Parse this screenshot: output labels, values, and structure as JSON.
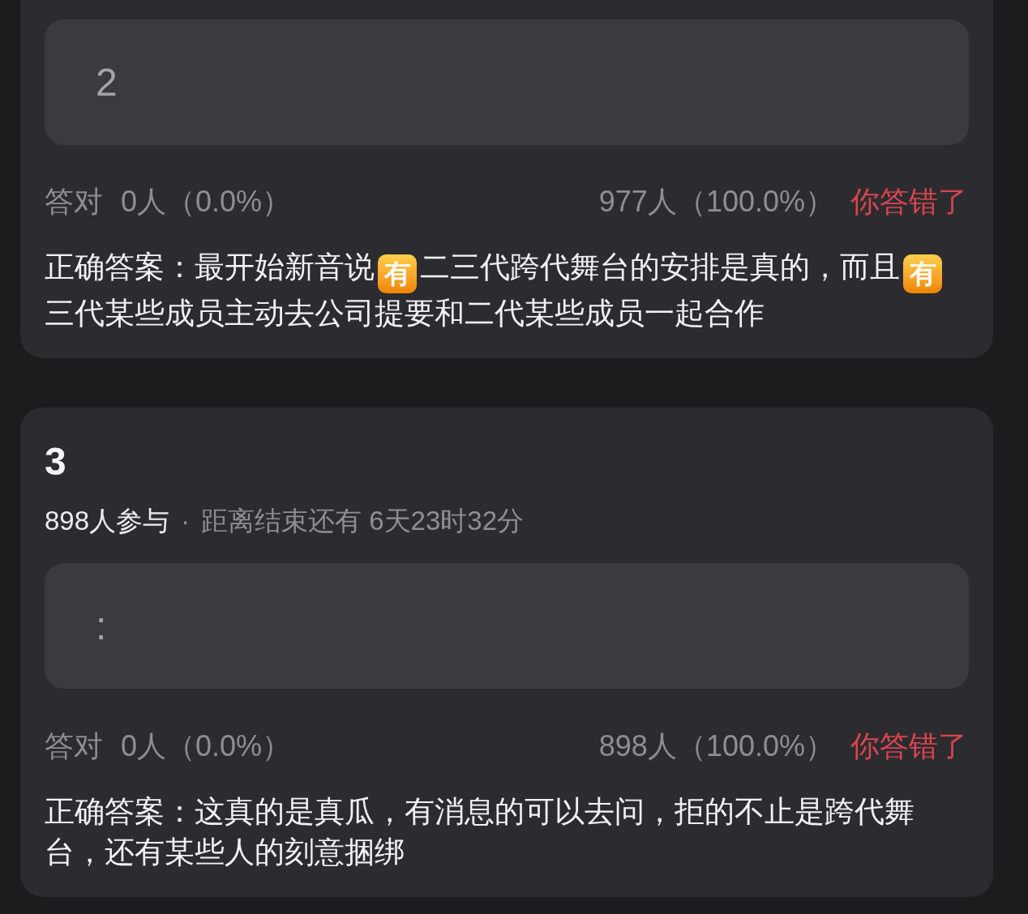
{
  "questions": [
    {
      "user_answer": "2",
      "stats": {
        "correct_label": "答对",
        "correct_count": "0人（0.0%）",
        "wrong_count": "977人（100.0%）",
        "result": "你答错了",
        "answered_correctly": false
      },
      "correct_answer": [
        {
          "kind": "text",
          "text": "正确答案：最开始新音说"
        },
        {
          "kind": "emoji",
          "text": "有"
        },
        {
          "kind": "text",
          "text": "二三代跨代舞台的安排是真的，而且"
        },
        {
          "kind": "emoji",
          "text": "有"
        },
        {
          "kind": "text",
          "text": "三代某些成员主动去公司提要和二代某些成员一起合作"
        }
      ]
    },
    {
      "number": "3",
      "participants": "898人参与",
      "separator": "·",
      "countdown": "距离结束还有 6天23时32分",
      "user_answer": ":",
      "stats": {
        "correct_label": "答对",
        "correct_count": "0人（0.0%）",
        "wrong_count": "898人（100.0%）",
        "result": "你答错了",
        "answered_correctly": false
      },
      "correct_answer": [
        {
          "kind": "text",
          "text": "正确答案：这真的是真瓜，有消息的可以去问，拒的不止是跨代舞台，还有某些人的刻意捆绑"
        }
      ]
    }
  ]
}
